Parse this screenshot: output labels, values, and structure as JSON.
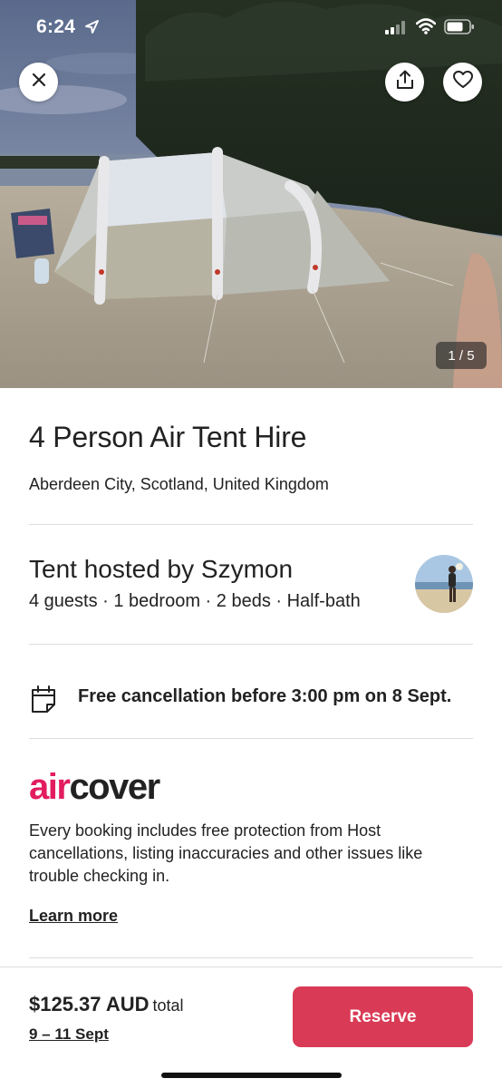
{
  "status_bar": {
    "time": "6:24",
    "icons": [
      "location-arrow-icon",
      "cellular-signal-icon",
      "wifi-icon",
      "battery-icon"
    ]
  },
  "gallery": {
    "counter": "1 / 5",
    "current_photo": 1,
    "total_photos": 5,
    "buttons": [
      "close-icon",
      "share-icon",
      "heart-icon"
    ]
  },
  "listing": {
    "title": "4 Person Air Tent Hire",
    "location": "Aberdeen City, Scotland, United Kingdom"
  },
  "host": {
    "title": "Tent hosted by Szymon",
    "details": "4 guests · 1 bedroom · 2 beds · Half-bath"
  },
  "cancellation": {
    "icon": "calendar-icon",
    "text": "Free cancellation before 3:00 pm on 8 Sept."
  },
  "aircover": {
    "logo_air": "air",
    "logo_cover": "cover",
    "description": "Every booking includes free protection from Host cancellations, listing inaccuracies and other issues like trouble checking in.",
    "link": "Learn more"
  },
  "footer": {
    "price": "$125.37 AUD",
    "price_suffix": "total",
    "dates": "9 – 11 Sept",
    "reserve_label": "Reserve"
  },
  "colors": {
    "brand": "#e31c5f",
    "reserve_button": "#d93a55",
    "text": "#222222",
    "divider": "#dddddd"
  }
}
